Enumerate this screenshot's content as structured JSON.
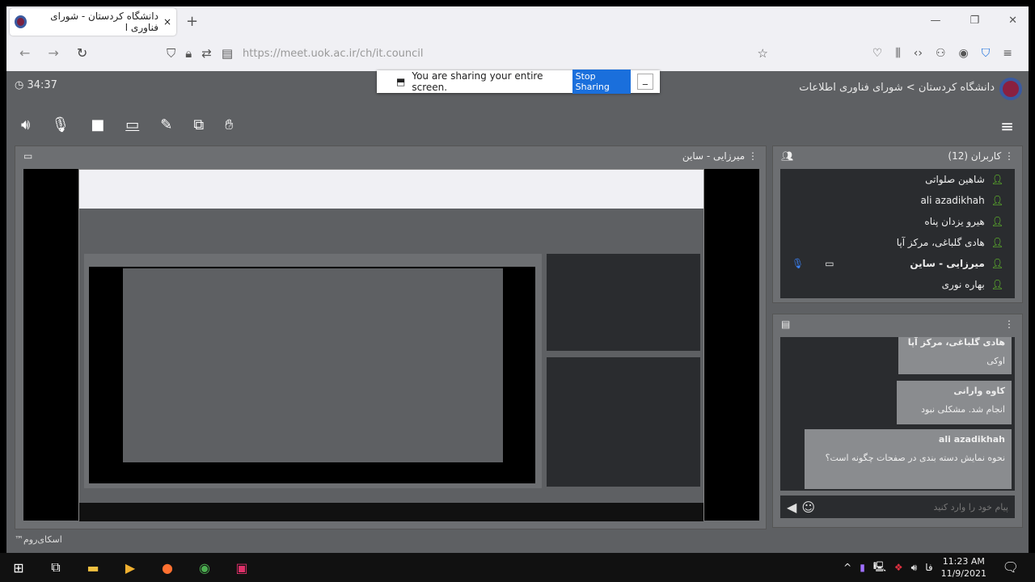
{
  "browser": {
    "tab_title": "دانشگاه کردستان - شورای فناوری ا",
    "url": "https://meet.uok.ac.ir/ch/it.council"
  },
  "share_bar": {
    "text": "You are sharing your entire screen.",
    "stop_label": "Stop Sharing"
  },
  "app": {
    "timer": "34:37",
    "title": "دانشگاه کردستان > شورای فناوری اطلاعات",
    "video_title": "میرزایی - ساین",
    "brand": "اسکای‌روم™"
  },
  "users": {
    "title": "کاربران (12)",
    "items": [
      {
        "name": "شاهین صلواتی"
      },
      {
        "name": "ali azadikhah"
      },
      {
        "name": "هیرو یزدان پناه"
      },
      {
        "name": "هادی گلباغی، مرکز آپا"
      },
      {
        "name": "میرزایی - ساین"
      },
      {
        "name": "بهاره نوری"
      }
    ]
  },
  "chat": {
    "messages": [
      {
        "sender": "هادی گلباغی، مرکز آپا",
        "text": "اوکی"
      },
      {
        "sender": "کاوه وارانی",
        "text": "انجام شد. مشکلی نبود"
      },
      {
        "sender": "ali azadikhah",
        "text": "نحوه نمایش دسته بندی در صفحات چگونه است؟"
      }
    ],
    "placeholder": "پیام خود را وارد کنید"
  },
  "taskbar": {
    "time": "11:23 AM",
    "date": "11/9/2021"
  }
}
